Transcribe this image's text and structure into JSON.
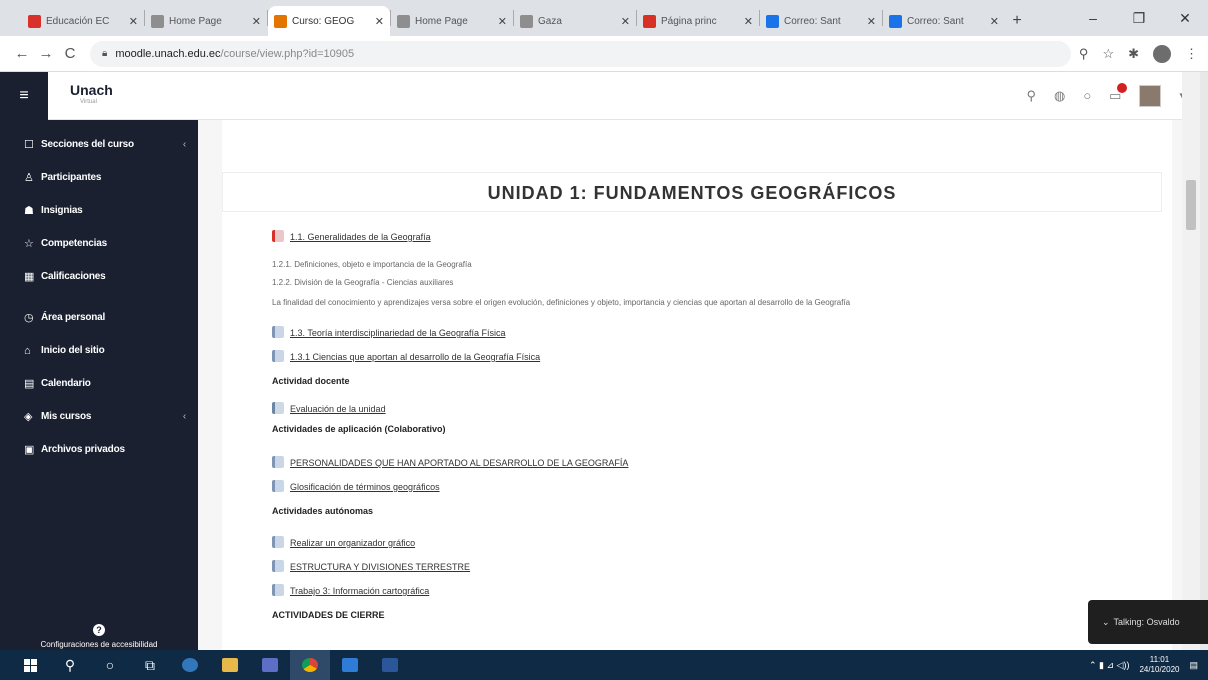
{
  "browser": {
    "tabs": [
      {
        "title": "Educación EC",
        "color": "#d9302c",
        "active": false
      },
      {
        "title": "Home Page",
        "color": "#8e8e8e",
        "active": false
      },
      {
        "title": "Curso: GEOG",
        "color": "#e37400",
        "active": true
      },
      {
        "title": "Home Page",
        "color": "#8e8e8e",
        "active": false
      },
      {
        "title": "Gaza",
        "color": "#8e8e8e",
        "active": false
      },
      {
        "title": "Página princ",
        "color": "#d93025",
        "active": false
      },
      {
        "title": "Correo: Sant",
        "color": "#1a73e8",
        "active": false
      },
      {
        "title": "Correo: Sant",
        "color": "#1a73e8",
        "active": false
      }
    ],
    "new_tab": "+",
    "minimize": "–",
    "maximize": "❐",
    "close": "✕",
    "back": "←",
    "forward": "→",
    "reload": "C",
    "url_host": "moodle.unach.edu.ec",
    "url_path": "/course/view.php?id=10905"
  },
  "moodle": {
    "menu_icon": "≡",
    "logo": "Unach",
    "logo_sub": "Virtual",
    "sidebar": [
      {
        "label": "Secciones del curso",
        "icon": "☐",
        "chevron": "‹"
      },
      {
        "label": "Participantes",
        "icon": "♙",
        "chevron": ""
      },
      {
        "label": "Insignias",
        "icon": "☗",
        "chevron": ""
      },
      {
        "label": "Competencias",
        "icon": "☆",
        "chevron": ""
      },
      {
        "label": "Calificaciones",
        "icon": "▦",
        "chevron": ""
      },
      {
        "label": "Área personal",
        "icon": "◷",
        "chevron": ""
      },
      {
        "label": "Inicio del sitio",
        "icon": "⌂",
        "chevron": ""
      },
      {
        "label": "Calendario",
        "icon": "▤",
        "chevron": ""
      },
      {
        "label": "Mis cursos",
        "icon": "◈",
        "chevron": "‹"
      },
      {
        "label": "Archivos privados",
        "icon": "▣",
        "chevron": ""
      }
    ],
    "accessibility_icon": "?",
    "accessibility_text": "Configuraciones de accesibilidad",
    "section_title": "UNIDAD 1: FUNDAMENTOS GEOGRÁFICOS",
    "items": [
      {
        "type": "pdf-link",
        "text": "1.1. Generalidades de la Geografía"
      },
      {
        "type": "plain",
        "text": "1.2.1. Definiciones, objeto e importancia de la Geografía"
      },
      {
        "type": "plain",
        "text": "1.2.2. División de la Geografía - Ciencias auxiliares"
      },
      {
        "type": "plain",
        "text": "La finalidad del conocimiento y aprendizajes versa sobre el origen evolución, definiciones y objeto, importancia y ciencias que aportan al desarrollo de la Geografía"
      },
      {
        "type": "file-link",
        "text": "1.3. Teoría interdisciplinariedad de la Geografía Física"
      },
      {
        "type": "file-link",
        "text": "1.3.1 Ciencias que aportan al desarrollo de la Geografía Física"
      },
      {
        "type": "subhead",
        "text": "Actividad docente"
      },
      {
        "type": "assign-link",
        "text": "Evaluación de la unidad"
      },
      {
        "type": "subhead",
        "text": "Actividades de aplicación (Colaborativo)"
      },
      {
        "type": "file-link",
        "text": "PERSONALIDADES QUE HAN APORTADO AL DESARROLLO DE LA GEOGRAFÍA"
      },
      {
        "type": "file-link",
        "text": "Glosificación de términos geográficos"
      },
      {
        "type": "subhead",
        "text": "Actividades autónomas"
      },
      {
        "type": "file-link",
        "text": "Realizar un organizador gráfico"
      },
      {
        "type": "file-link",
        "text": "ESTRUCTURA Y DIVISIONES TERRESTRE"
      },
      {
        "type": "file-link",
        "text": "Trabajo 3: Información cartográfica"
      },
      {
        "type": "subhead",
        "text": "ACTIVIDADES DE CIERRE"
      }
    ],
    "toast": "Talking: Osvaldo"
  },
  "taskbar": {
    "time": "11:01",
    "date": "24/10/2020",
    "tray_icons": "⌃ ▮ ⊿ ◁))"
  }
}
